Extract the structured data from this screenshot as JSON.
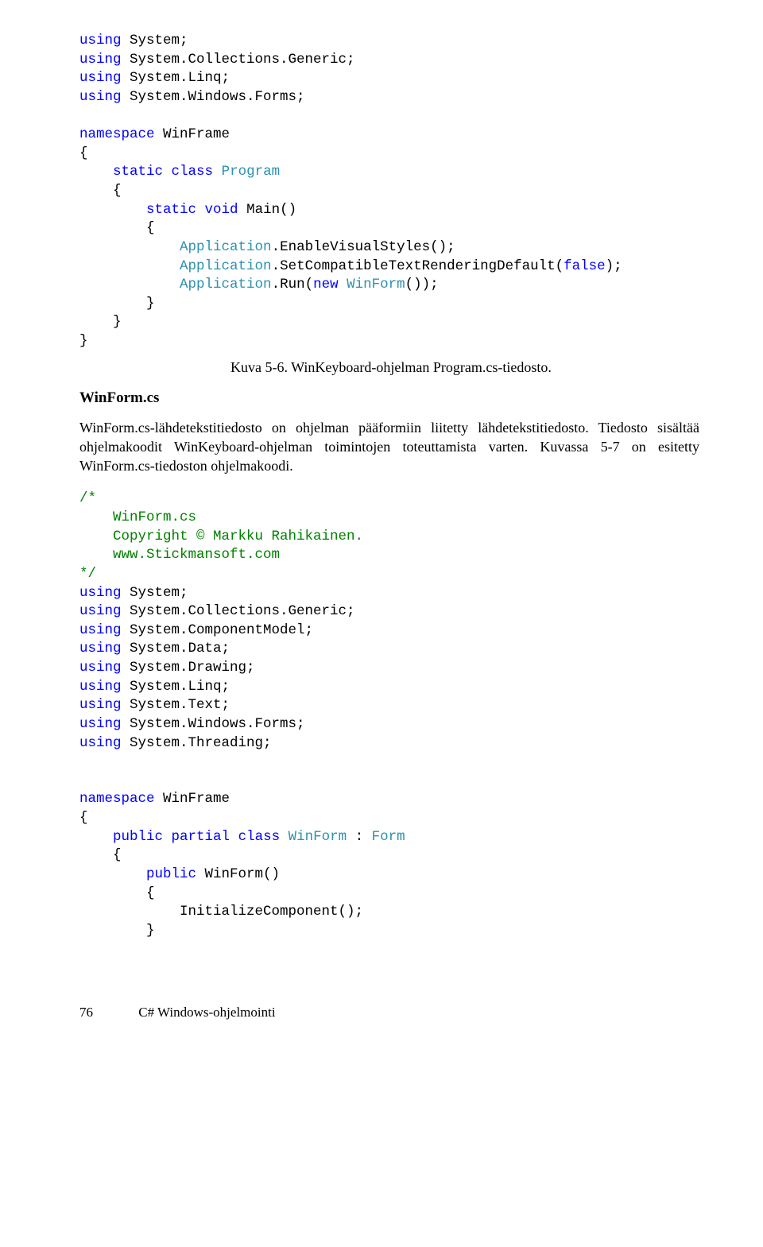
{
  "code1": {
    "lines": [
      [
        [
          "kw",
          "using"
        ],
        [
          "",
          " System;"
        ]
      ],
      [
        [
          "kw",
          "using"
        ],
        [
          "",
          " System.Collections.Generic;"
        ]
      ],
      [
        [
          "kw",
          "using"
        ],
        [
          "",
          " System.Linq;"
        ]
      ],
      [
        [
          "kw",
          "using"
        ],
        [
          "",
          " System.Windows.Forms;"
        ]
      ],
      [
        [
          "",
          ""
        ]
      ],
      [
        [
          "kw",
          "namespace"
        ],
        [
          "",
          " WinFrame"
        ]
      ],
      [
        [
          "",
          "{"
        ]
      ],
      [
        [
          "",
          "    "
        ],
        [
          "kw",
          "static"
        ],
        [
          "",
          " "
        ],
        [
          "kw",
          "class"
        ],
        [
          "",
          " "
        ],
        [
          "cls",
          "Program"
        ]
      ],
      [
        [
          "",
          "    {"
        ]
      ],
      [
        [
          "",
          "        "
        ],
        [
          "kw",
          "static"
        ],
        [
          "",
          " "
        ],
        [
          "kw",
          "void"
        ],
        [
          "",
          " Main()"
        ]
      ],
      [
        [
          "",
          "        {"
        ]
      ],
      [
        [
          "",
          "            "
        ],
        [
          "cls",
          "Application"
        ],
        [
          "",
          ".EnableVisualStyles();"
        ]
      ],
      [
        [
          "",
          "            "
        ],
        [
          "cls",
          "Application"
        ],
        [
          "",
          ".SetCompatibleTextRenderingDefault("
        ],
        [
          "kw",
          "false"
        ],
        [
          "",
          ");"
        ]
      ],
      [
        [
          "",
          "            "
        ],
        [
          "cls",
          "Application"
        ],
        [
          "",
          ".Run("
        ],
        [
          "kw",
          "new"
        ],
        [
          "",
          " "
        ],
        [
          "cls",
          "WinForm"
        ],
        [
          "",
          "());"
        ]
      ],
      [
        [
          "",
          "        }"
        ]
      ],
      [
        [
          "",
          "    }"
        ]
      ],
      [
        [
          "",
          "}"
        ]
      ]
    ]
  },
  "caption1": "Kuva 5-6. WinKeyboard-ohjelman Program.cs-tiedosto.",
  "heading1": "WinForm.cs",
  "paragraph1": "WinForm.cs-lähdetekstitiedosto on ohjelman pääformiin liitetty lähdetekstitiedosto. Tiedosto sisältää ohjelmakoodit WinKeyboard-ohjelman toimintojen toteuttamista varten. Kuvassa 5-7 on esitetty WinForm.cs-tiedoston ohjelmakoodi.",
  "code2": {
    "lines": [
      [
        [
          "com",
          "/*"
        ]
      ],
      [
        [
          "com",
          "    WinForm.cs"
        ]
      ],
      [
        [
          "com",
          "    Copyright © Markku Rahikainen."
        ]
      ],
      [
        [
          "com",
          "    www.Stickmansoft.com"
        ]
      ],
      [
        [
          "com",
          "*/"
        ]
      ],
      [
        [
          "kw",
          "using"
        ],
        [
          "",
          " System;"
        ]
      ],
      [
        [
          "kw",
          "using"
        ],
        [
          "",
          " System.Collections.Generic;"
        ]
      ],
      [
        [
          "kw",
          "using"
        ],
        [
          "",
          " System.ComponentModel;"
        ]
      ],
      [
        [
          "kw",
          "using"
        ],
        [
          "",
          " System.Data;"
        ]
      ],
      [
        [
          "kw",
          "using"
        ],
        [
          "",
          " System.Drawing;"
        ]
      ],
      [
        [
          "kw",
          "using"
        ],
        [
          "",
          " System.Linq;"
        ]
      ],
      [
        [
          "kw",
          "using"
        ],
        [
          "",
          " System.Text;"
        ]
      ],
      [
        [
          "kw",
          "using"
        ],
        [
          "",
          " System.Windows.Forms;"
        ]
      ],
      [
        [
          "kw",
          "using"
        ],
        [
          "",
          " System.Threading;"
        ]
      ],
      [
        [
          "",
          ""
        ]
      ],
      [
        [
          "",
          ""
        ]
      ],
      [
        [
          "kw",
          "namespace"
        ],
        [
          "",
          " WinFrame"
        ]
      ],
      [
        [
          "",
          "{"
        ]
      ],
      [
        [
          "",
          "    "
        ],
        [
          "kw",
          "public"
        ],
        [
          "",
          " "
        ],
        [
          "kw",
          "partial"
        ],
        [
          "",
          " "
        ],
        [
          "kw",
          "class"
        ],
        [
          "",
          " "
        ],
        [
          "cls",
          "WinForm"
        ],
        [
          "",
          " : "
        ],
        [
          "cls",
          "Form"
        ]
      ],
      [
        [
          "",
          "    {"
        ]
      ],
      [
        [
          "",
          "        "
        ],
        [
          "kw",
          "public"
        ],
        [
          "",
          " WinForm()"
        ]
      ],
      [
        [
          "",
          "        {"
        ]
      ],
      [
        [
          "",
          "            InitializeComponent();"
        ]
      ],
      [
        [
          "",
          "        }"
        ]
      ]
    ]
  },
  "footer": {
    "page": "76",
    "title": "C# Windows-ohjelmointi"
  }
}
